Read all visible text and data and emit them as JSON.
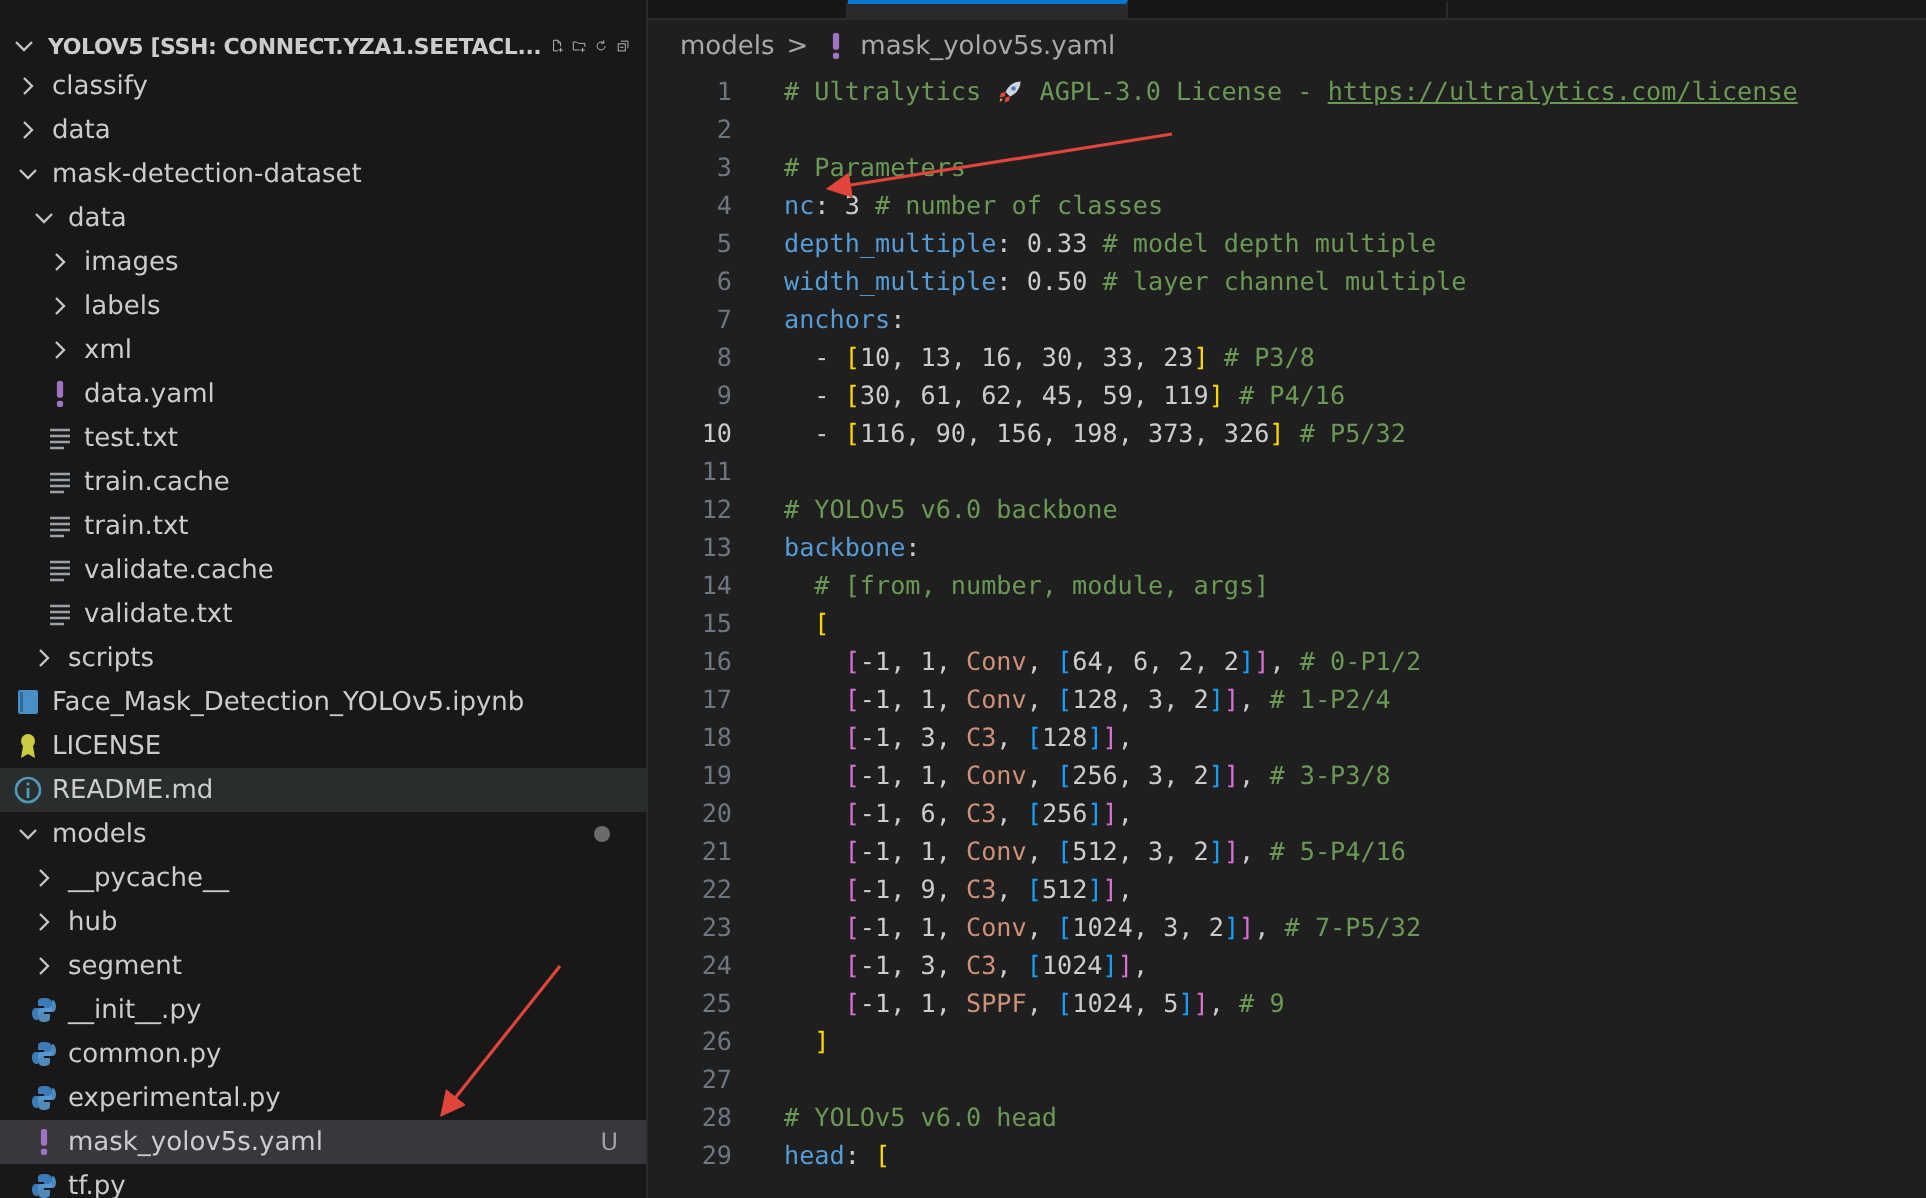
{
  "explorer": {
    "title": "YOLOV5 [SSH: CONNECT.YZA1.SEETACL...",
    "actions": [
      {
        "kind": "new-file"
      },
      {
        "kind": "new-folder"
      },
      {
        "kind": "refresh"
      },
      {
        "kind": "collapse"
      }
    ],
    "tree": [
      {
        "name": "classify",
        "kind": "folder",
        "expanded": false
      },
      {
        "name": "data",
        "kind": "folder",
        "expanded": false
      },
      {
        "name": "mask-detection-dataset",
        "kind": "folder",
        "expanded": true,
        "children": [
          {
            "name": "data",
            "kind": "folder",
            "expanded": true,
            "children": [
              {
                "name": "images",
                "kind": "folder",
                "expanded": false
              },
              {
                "name": "labels",
                "kind": "folder",
                "expanded": false
              },
              {
                "name": "xml",
                "kind": "folder",
                "expanded": false
              },
              {
                "name": "data.yaml",
                "kind": "yaml"
              },
              {
                "name": "test.txt",
                "kind": "text"
              },
              {
                "name": "train.cache",
                "kind": "text"
              },
              {
                "name": "train.txt",
                "kind": "text"
              },
              {
                "name": "validate.cache",
                "kind": "text"
              },
              {
                "name": "validate.txt",
                "kind": "text"
              }
            ]
          },
          {
            "name": "scripts",
            "kind": "folder",
            "expanded": false
          }
        ]
      },
      {
        "name": "Face_Mask_Detection_YOLOv5.ipynb",
        "kind": "notebook"
      },
      {
        "name": "LICENSE",
        "kind": "license"
      },
      {
        "name": "README.md",
        "kind": "info",
        "hovered": true
      },
      {
        "name": "models",
        "kind": "folder",
        "expanded": true,
        "modified": true,
        "children": [
          {
            "name": "__pycache__",
            "kind": "folder",
            "expanded": false
          },
          {
            "name": "hub",
            "kind": "folder",
            "expanded": false
          },
          {
            "name": "segment",
            "kind": "folder",
            "expanded": false
          },
          {
            "name": "__init__.py",
            "kind": "python"
          },
          {
            "name": "common.py",
            "kind": "python"
          },
          {
            "name": "experimental.py",
            "kind": "python"
          },
          {
            "name": "mask_yolov5s.yaml",
            "kind": "yaml",
            "selected": true,
            "badge": "U"
          },
          {
            "name": "tf.py",
            "kind": "python"
          }
        ]
      }
    ]
  },
  "tabs": [
    {
      "selected": false
    },
    {
      "selected": true
    },
    {
      "selected": false
    }
  ],
  "breadcrumb": {
    "folder": "models",
    "separator": ">",
    "file": "mask_yolov5s.yaml"
  },
  "editor": {
    "lines": [
      {
        "number": "1",
        "tokens": [
          {
            "kind": "comment",
            "text": "# Ultralytics "
          },
          {
            "kind": "rocket"
          },
          {
            "kind": "comment",
            "text": " AGPL-3.0 License - "
          },
          {
            "kind": "link",
            "text": "https://ultralytics.com/license"
          }
        ]
      },
      {
        "number": "2"
      },
      {
        "number": "3",
        "tokens": [
          {
            "kind": "comment",
            "text": "# Parameters"
          }
        ]
      },
      {
        "number": "4",
        "tokens": [
          {
            "kind": "key",
            "text": "nc"
          },
          {
            "kind": "plain",
            "text": ": 3"
          },
          {
            "kind": "comment",
            "text": " # number of classes"
          }
        ]
      },
      {
        "number": "5",
        "tokens": [
          {
            "kind": "key",
            "text": "depth_multiple"
          },
          {
            "kind": "plain",
            "text": ": 0.33"
          },
          {
            "kind": "comment",
            "text": " # model depth multiple"
          }
        ]
      },
      {
        "number": "6",
        "tokens": [
          {
            "kind": "key",
            "text": "width_multiple"
          },
          {
            "kind": "plain",
            "text": ": 0.50"
          },
          {
            "kind": "comment",
            "text": " # layer channel multiple"
          }
        ]
      },
      {
        "number": "7",
        "tokens": [
          {
            "kind": "key",
            "text": "anchors"
          },
          {
            "kind": "plain",
            "text": ":"
          }
        ]
      },
      {
        "number": "8",
        "tokens": [
          {
            "kind": "plain",
            "text": "  - "
          },
          {
            "kind": "bracket1",
            "text": "["
          },
          {
            "kind": "plain",
            "text": "10, 13, 16, 30, 33, 23"
          },
          {
            "kind": "bracket1",
            "text": "]"
          },
          {
            "kind": "comment",
            "text": " # P3/8"
          }
        ]
      },
      {
        "number": "9",
        "tokens": [
          {
            "kind": "plain",
            "text": "  - "
          },
          {
            "kind": "bracket1",
            "text": "["
          },
          {
            "kind": "plain",
            "text": "30, 61, 62, 45, 59, 119"
          },
          {
            "kind": "bracket1",
            "text": "]"
          },
          {
            "kind": "comment",
            "text": " # P4/16"
          }
        ]
      },
      {
        "number": "10",
        "current": true,
        "tokens": [
          {
            "kind": "plain",
            "text": "  - "
          },
          {
            "kind": "bracket1",
            "text": "["
          },
          {
            "kind": "plain",
            "text": "116, 90, 156, 198, 373, 326"
          },
          {
            "kind": "bracket1",
            "text": "]"
          },
          {
            "kind": "comment",
            "text": " # P5/32"
          }
        ]
      },
      {
        "number": "11"
      },
      {
        "number": "12",
        "tokens": [
          {
            "kind": "comment",
            "text": "# YOLOv5 v6.0 backbone"
          }
        ]
      },
      {
        "number": "13",
        "tokens": [
          {
            "kind": "key",
            "text": "backbone"
          },
          {
            "kind": "plain",
            "text": ":"
          }
        ]
      },
      {
        "number": "14",
        "tokens": [
          {
            "kind": "comment",
            "text": "  # [from, number, module, args]"
          }
        ]
      },
      {
        "number": "15",
        "tokens": [
          {
            "kind": "bracket1",
            "text": "  ["
          }
        ]
      },
      {
        "number": "16",
        "tokens": [
          {
            "kind": "bracket2",
            "text": "    ["
          },
          {
            "kind": "plain",
            "text": "-1, 1, "
          },
          {
            "kind": "module",
            "text": "Conv"
          },
          {
            "kind": "plain",
            "text": ", "
          },
          {
            "kind": "bracket3",
            "text": "["
          },
          {
            "kind": "plain",
            "text": "64, 6, 2, 2"
          },
          {
            "kind": "bracket3",
            "text": "]"
          },
          {
            "kind": "bracket2",
            "text": "]"
          },
          {
            "kind": "plain",
            "text": ","
          },
          {
            "kind": "comment",
            "text": " # 0-P1/2"
          }
        ]
      },
      {
        "number": "17",
        "tokens": [
          {
            "kind": "bracket2",
            "text": "    ["
          },
          {
            "kind": "plain",
            "text": "-1, 1, "
          },
          {
            "kind": "module",
            "text": "Conv"
          },
          {
            "kind": "plain",
            "text": ", "
          },
          {
            "kind": "bracket3",
            "text": "["
          },
          {
            "kind": "plain",
            "text": "128, 3, 2"
          },
          {
            "kind": "bracket3",
            "text": "]"
          },
          {
            "kind": "bracket2",
            "text": "]"
          },
          {
            "kind": "plain",
            "text": ","
          },
          {
            "kind": "comment",
            "text": " # 1-P2/4"
          }
        ]
      },
      {
        "number": "18",
        "tokens": [
          {
            "kind": "bracket2",
            "text": "    ["
          },
          {
            "kind": "plain",
            "text": "-1, 3, "
          },
          {
            "kind": "module",
            "text": "C3"
          },
          {
            "kind": "plain",
            "text": ", "
          },
          {
            "kind": "bracket3",
            "text": "["
          },
          {
            "kind": "plain",
            "text": "128"
          },
          {
            "kind": "bracket3",
            "text": "]"
          },
          {
            "kind": "bracket2",
            "text": "]"
          },
          {
            "kind": "plain",
            "text": ","
          }
        ]
      },
      {
        "number": "19",
        "tokens": [
          {
            "kind": "bracket2",
            "text": "    ["
          },
          {
            "kind": "plain",
            "text": "-1, 1, "
          },
          {
            "kind": "module",
            "text": "Conv"
          },
          {
            "kind": "plain",
            "text": ", "
          },
          {
            "kind": "bracket3",
            "text": "["
          },
          {
            "kind": "plain",
            "text": "256, 3, 2"
          },
          {
            "kind": "bracket3",
            "text": "]"
          },
          {
            "kind": "bracket2",
            "text": "]"
          },
          {
            "kind": "plain",
            "text": ","
          },
          {
            "kind": "comment",
            "text": " # 3-P3/8"
          }
        ]
      },
      {
        "number": "20",
        "tokens": [
          {
            "kind": "bracket2",
            "text": "    ["
          },
          {
            "kind": "plain",
            "text": "-1, 6, "
          },
          {
            "kind": "module",
            "text": "C3"
          },
          {
            "kind": "plain",
            "text": ", "
          },
          {
            "kind": "bracket3",
            "text": "["
          },
          {
            "kind": "plain",
            "text": "256"
          },
          {
            "kind": "bracket3",
            "text": "]"
          },
          {
            "kind": "bracket2",
            "text": "]"
          },
          {
            "kind": "plain",
            "text": ","
          }
        ]
      },
      {
        "number": "21",
        "tokens": [
          {
            "kind": "bracket2",
            "text": "    ["
          },
          {
            "kind": "plain",
            "text": "-1, 1, "
          },
          {
            "kind": "module",
            "text": "Conv"
          },
          {
            "kind": "plain",
            "text": ", "
          },
          {
            "kind": "bracket3",
            "text": "["
          },
          {
            "kind": "plain",
            "text": "512, 3, 2"
          },
          {
            "kind": "bracket3",
            "text": "]"
          },
          {
            "kind": "bracket2",
            "text": "]"
          },
          {
            "kind": "plain",
            "text": ","
          },
          {
            "kind": "comment",
            "text": " # 5-P4/16"
          }
        ]
      },
      {
        "number": "22",
        "tokens": [
          {
            "kind": "bracket2",
            "text": "    ["
          },
          {
            "kind": "plain",
            "text": "-1, 9, "
          },
          {
            "kind": "module",
            "text": "C3"
          },
          {
            "kind": "plain",
            "text": ", "
          },
          {
            "kind": "bracket3",
            "text": "["
          },
          {
            "kind": "plain",
            "text": "512"
          },
          {
            "kind": "bracket3",
            "text": "]"
          },
          {
            "kind": "bracket2",
            "text": "]"
          },
          {
            "kind": "plain",
            "text": ","
          }
        ]
      },
      {
        "number": "23",
        "tokens": [
          {
            "kind": "bracket2",
            "text": "    ["
          },
          {
            "kind": "plain",
            "text": "-1, 1, "
          },
          {
            "kind": "module",
            "text": "Conv"
          },
          {
            "kind": "plain",
            "text": ", "
          },
          {
            "kind": "bracket3",
            "text": "["
          },
          {
            "kind": "plain",
            "text": "1024, 3, 2"
          },
          {
            "kind": "bracket3",
            "text": "]"
          },
          {
            "kind": "bracket2",
            "text": "]"
          },
          {
            "kind": "plain",
            "text": ","
          },
          {
            "kind": "comment",
            "text": " # 7-P5/32"
          }
        ]
      },
      {
        "number": "24",
        "tokens": [
          {
            "kind": "bracket2",
            "text": "    ["
          },
          {
            "kind": "plain",
            "text": "-1, 3, "
          },
          {
            "kind": "module",
            "text": "C3"
          },
          {
            "kind": "plain",
            "text": ", "
          },
          {
            "kind": "bracket3",
            "text": "["
          },
          {
            "kind": "plain",
            "text": "1024"
          },
          {
            "kind": "bracket3",
            "text": "]"
          },
          {
            "kind": "bracket2",
            "text": "]"
          },
          {
            "kind": "plain",
            "text": ","
          }
        ]
      },
      {
        "number": "25",
        "tokens": [
          {
            "kind": "bracket2",
            "text": "    ["
          },
          {
            "kind": "plain",
            "text": "-1, 1, "
          },
          {
            "kind": "module",
            "text": "SPPF"
          },
          {
            "kind": "plain",
            "text": ", "
          },
          {
            "kind": "bracket3",
            "text": "["
          },
          {
            "kind": "plain",
            "text": "1024, 5"
          },
          {
            "kind": "bracket3",
            "text": "]"
          },
          {
            "kind": "bracket2",
            "text": "]"
          },
          {
            "kind": "plain",
            "text": ","
          },
          {
            "kind": "comment",
            "text": " # 9"
          }
        ]
      },
      {
        "number": "26",
        "tokens": [
          {
            "kind": "bracket1",
            "text": "  ]"
          }
        ]
      },
      {
        "number": "27"
      },
      {
        "number": "28",
        "tokens": [
          {
            "kind": "comment",
            "text": "# YOLOv5 v6.0 head"
          }
        ]
      },
      {
        "number": "29",
        "tokens": [
          {
            "kind": "key",
            "text": "head"
          },
          {
            "kind": "plain",
            "text": ": "
          },
          {
            "kind": "bracket1",
            "text": "["
          }
        ]
      }
    ]
  }
}
